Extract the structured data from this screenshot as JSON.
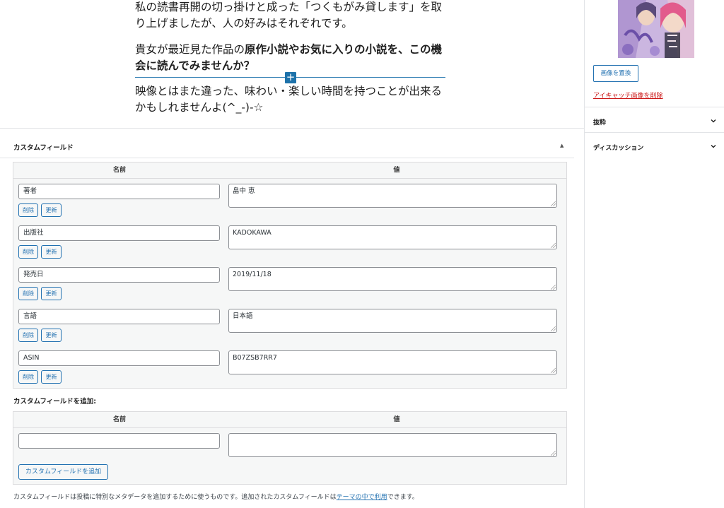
{
  "editor": {
    "para1": "私の読書再開の切っ掛けと成った「つくもがみ貸します」を取り上げましたが、人の好みはそれぞれです。",
    "para2_pre": "貴女が最近見た作品の",
    "para2_bold": "原作小説やお気に入りの小説を、この機会に読んでみませんか？",
    "para3": "映像とはまた違った、味わい・楽しい時間を持つことが出来るかもしれませんよ(^_-)-☆",
    "inserter": "+"
  },
  "custom_fields": {
    "title": "カスタムフィールド",
    "toggle": "▲",
    "col_name": "名前",
    "col_value": "値",
    "delete_label": "削除",
    "update_label": "更新",
    "rows": [
      {
        "name": "著者",
        "value": "畠中 恵"
      },
      {
        "name": "出版社",
        "value": "KADOKAWA"
      },
      {
        "name": "発売日",
        "value": "2019/11/18"
      },
      {
        "name": "言語",
        "value": "日本語"
      },
      {
        "name": "ASIN",
        "value": "B07ZSB7RR7"
      }
    ],
    "add_title": "カスタムフィールドを追加:",
    "add_button": "カスタムフィールドを追加",
    "footnote_pre": "カスタムフィールドは投稿に特別なメタデータを追加するために使うものです。追加されたカスタムフィールドは",
    "footnote_link": "テーマの中で利用",
    "footnote_post": "できます。"
  },
  "sidebar": {
    "replace_image": "画像を置換",
    "remove_image": "アイキャッチ画像を削除",
    "panels": [
      {
        "label": "抜粋"
      },
      {
        "label": "ディスカッション"
      }
    ]
  }
}
